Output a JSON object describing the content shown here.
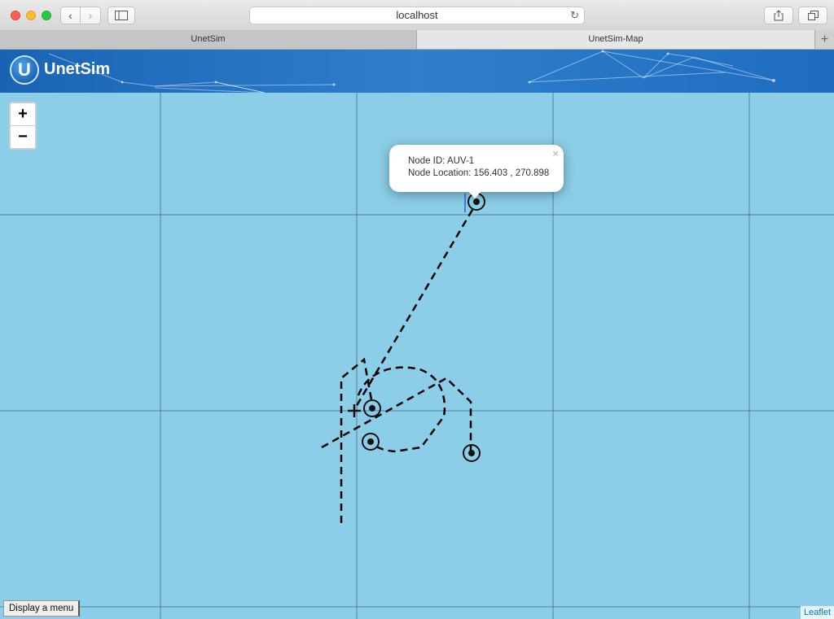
{
  "browser": {
    "address": "localhost",
    "tabs": [
      {
        "label": "UnetSim",
        "active": false
      },
      {
        "label": "UnetSim-Map",
        "active": true
      }
    ],
    "new_tab_label": "+"
  },
  "header": {
    "logo_letter": "U",
    "app_name": "UnetSim"
  },
  "map": {
    "zoom_in_label": "+",
    "zoom_out_label": "−",
    "popup": {
      "node_id_line": "Node ID: AUV-1",
      "location_line": "Node Location: 156.403 , 270.898",
      "close_label": "×"
    },
    "menu_button_label": "Display a menu",
    "attribution": "Leaflet",
    "background_color": "#8ccde8"
  }
}
